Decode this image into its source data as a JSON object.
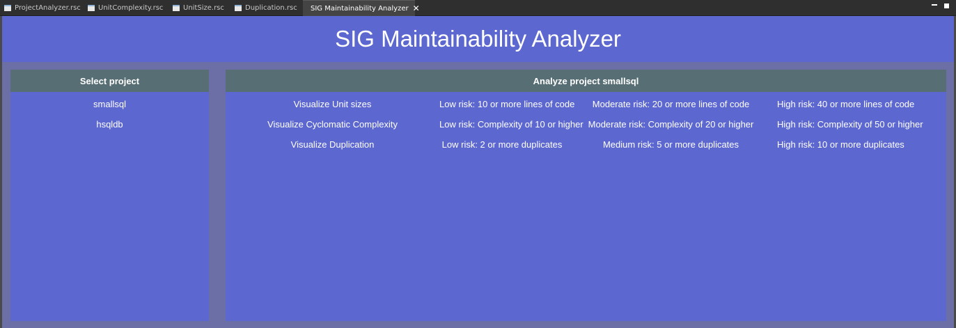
{
  "tabs": [
    {
      "label": "ProjectAnalyzer.rsc",
      "active": false
    },
    {
      "label": "UnitComplexity.rsc",
      "active": false
    },
    {
      "label": "UnitSize.rsc",
      "active": false
    },
    {
      "label": "Duplication.rsc",
      "active": false
    },
    {
      "label": "SIG Maintainability Analyzer",
      "active": true
    }
  ],
  "window_controls": {
    "minimize": "minimize-icon",
    "maximize": "maximize-icon"
  },
  "app": {
    "title": "SIG Maintainability Analyzer",
    "colors": {
      "banner": "#5c67cf",
      "background": "#6b6fa6",
      "panel_header": "#566e74"
    }
  },
  "left_panel": {
    "header": "Select project",
    "projects": [
      "smallsql",
      "hsqldb"
    ]
  },
  "right_panel": {
    "header": "Analyze project smallsql",
    "rows": [
      {
        "action": "Visualize Unit sizes",
        "low": "Low risk: 10 or more lines of code",
        "moderate": "Moderate risk: 20 or more lines of code",
        "high": "High risk: 40 or more lines of code"
      },
      {
        "action": "Visualize Cyclomatic Complexity",
        "low": "Low risk: Complexity of 10 or higher",
        "moderate": "Moderate risk: Complexity of 20 or higher",
        "high": "High risk: Complexity of 50 or higher"
      },
      {
        "action": "Visualize Duplication",
        "low": "Low risk: 2 or more duplicates",
        "moderate": "Medium risk: 5 or more duplicates",
        "high": "High risk: 10 or more duplicates"
      }
    ]
  }
}
